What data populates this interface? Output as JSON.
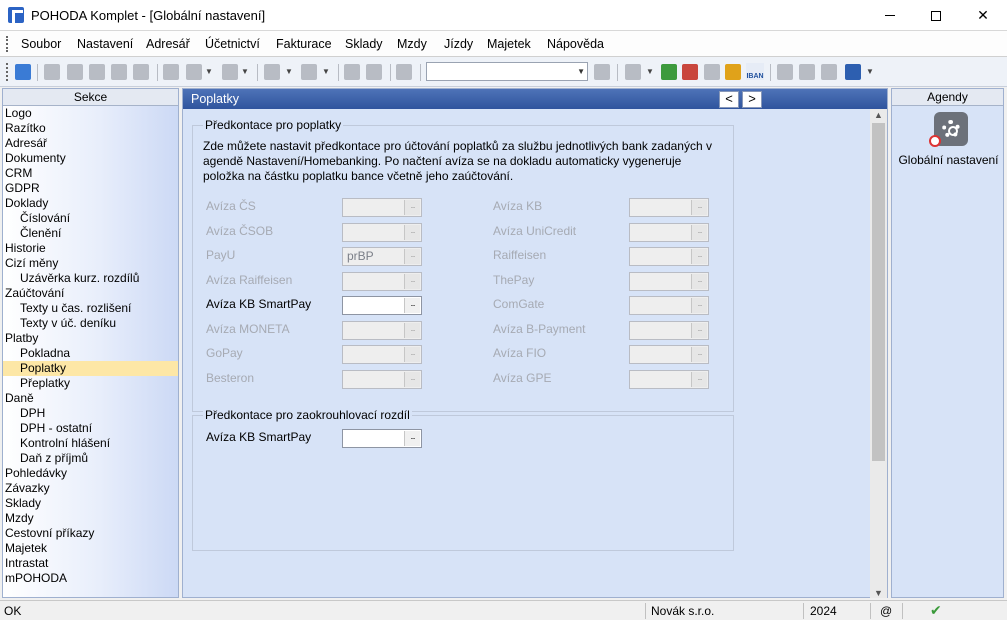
{
  "window": {
    "title": "POHODA Komplet - [Globální nastavení]"
  },
  "menu": [
    "Soubor",
    "Nastavení",
    "Adresář",
    "Účetnictví",
    "Fakturace",
    "Sklady",
    "Mzdy",
    "Jízdy",
    "Majetek",
    "Nápověda"
  ],
  "toolbar": {
    "iban_label": "IBAN",
    "combo_value": ""
  },
  "sections": {
    "header": "Sekce",
    "items": [
      {
        "label": "Logo",
        "sub": false
      },
      {
        "label": "Razítko",
        "sub": false
      },
      {
        "label": "Adresář",
        "sub": false
      },
      {
        "label": "Dokumenty",
        "sub": false
      },
      {
        "label": "CRM",
        "sub": false
      },
      {
        "label": "GDPR",
        "sub": false
      },
      {
        "label": "Doklady",
        "sub": false
      },
      {
        "label": "Číslování",
        "sub": true
      },
      {
        "label": "Členění",
        "sub": true
      },
      {
        "label": "Historie",
        "sub": false
      },
      {
        "label": "Cizí měny",
        "sub": false
      },
      {
        "label": "Uzávěrka kurz. rozdílů",
        "sub": true
      },
      {
        "label": "Zaúčtování",
        "sub": false
      },
      {
        "label": "Texty u čas. rozlišení",
        "sub": true
      },
      {
        "label": "Texty v úč. deníku",
        "sub": true
      },
      {
        "label": "Platby",
        "sub": false
      },
      {
        "label": "Pokladna",
        "sub": true
      },
      {
        "label": "Poplatky",
        "sub": true,
        "selected": true
      },
      {
        "label": "Přeplatky",
        "sub": true
      },
      {
        "label": "Daně",
        "sub": false
      },
      {
        "label": "DPH",
        "sub": true
      },
      {
        "label": "DPH - ostatní",
        "sub": true
      },
      {
        "label": "Kontrolní hlášení",
        "sub": true
      },
      {
        "label": "Daň z příjmů",
        "sub": true
      },
      {
        "label": "Pohledávky",
        "sub": false
      },
      {
        "label": "Závazky",
        "sub": false
      },
      {
        "label": "Sklady",
        "sub": false
      },
      {
        "label": "Mzdy",
        "sub": false
      },
      {
        "label": "Cestovní příkazy",
        "sub": false
      },
      {
        "label": "Majetek",
        "sub": false
      },
      {
        "label": "Intrastat",
        "sub": false
      },
      {
        "label": "mPOHODA",
        "sub": false
      }
    ]
  },
  "content": {
    "title": "Poplatky",
    "nav_prev": "<",
    "nav_next": ">",
    "group1_title": "Předkontace pro poplatky",
    "description": "Zde můžete nastavit předkontace pro účtování poplatků za službu jednotlivých bank zadaných v agendě Nastavení/Homebanking. Po načtení avíza se na dokladu automaticky vygeneruje položka na částku poplatku bance včetně jeho zaúčtování.",
    "left_fields": [
      {
        "label": "Avíza ČS",
        "value": "",
        "enabled": false
      },
      {
        "label": "Avíza ČSOB",
        "value": "",
        "enabled": false
      },
      {
        "label": "PayU",
        "value": "prBP",
        "enabled": false
      },
      {
        "label": "Avíza Raiffeisen",
        "value": "",
        "enabled": false
      },
      {
        "label": "Avíza KB SmartPay",
        "value": "",
        "enabled": true
      },
      {
        "label": "Avíza MONETA",
        "value": "",
        "enabled": false
      },
      {
        "label": "GoPay",
        "value": "",
        "enabled": false
      },
      {
        "label": "Besteron",
        "value": "",
        "enabled": false
      }
    ],
    "right_fields": [
      {
        "label": "Avíza KB",
        "value": "",
        "enabled": false
      },
      {
        "label": "Avíza UniCredit",
        "value": "",
        "enabled": false
      },
      {
        "label": "Raiffeisen",
        "value": "",
        "enabled": false
      },
      {
        "label": "ThePay",
        "value": "",
        "enabled": false
      },
      {
        "label": "ComGate",
        "value": "",
        "enabled": false
      },
      {
        "label": "Avíza B-Payment",
        "value": "",
        "enabled": false
      },
      {
        "label": "Avíza FIO",
        "value": "",
        "enabled": false
      },
      {
        "label": "Avíza GPE",
        "value": "",
        "enabled": false
      }
    ],
    "group2_title": "Předkontace pro zaokrouhlovací rozdíl",
    "rounding_field": {
      "label": "Avíza KB SmartPay",
      "value": ""
    },
    "picker_glyph": "..."
  },
  "agendas": {
    "header": "Agendy",
    "item_label": "Globální nastavení"
  },
  "status": {
    "state": "OK",
    "company": "Novák s.r.o.",
    "year": "2024",
    "at": "@"
  }
}
